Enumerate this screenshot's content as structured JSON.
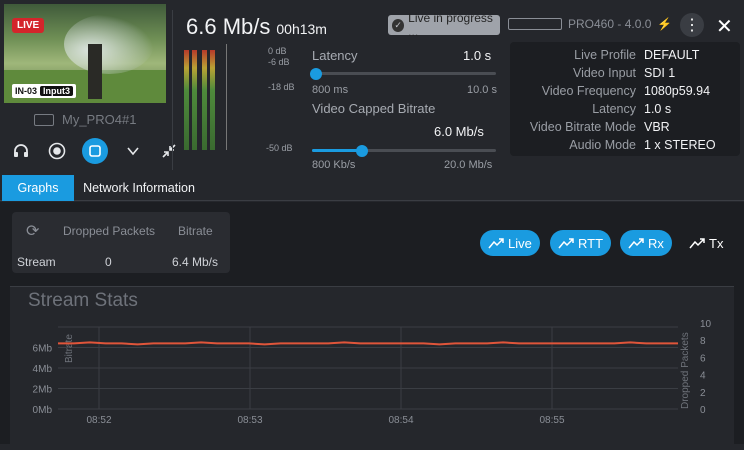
{
  "preview": {
    "live_badge": "LIVE",
    "input_code": "IN-03",
    "input_tag": "Input3",
    "device_name": "My_PRO4#1"
  },
  "header": {
    "bitrate": "6.6 Mb/s",
    "duration": "00h13m",
    "status": "Live in progress ...",
    "device_version": "PRO460 - 4.0.0"
  },
  "audio_meter": {
    "scale": [
      "0 dB",
      "-6 dB",
      "-18 dB",
      "-50 dB"
    ]
  },
  "latency": {
    "label": "Latency",
    "value": "1.0 s",
    "min": "800 ms",
    "max": "10.0 s",
    "position": 0.02
  },
  "capped_bitrate": {
    "label": "Video Capped Bitrate",
    "value": "6.0 Mb/s",
    "min": "800 Kb/s",
    "max": "20.0 Mb/s",
    "position": 0.27
  },
  "info": [
    {
      "k": "Live Profile",
      "v": "DEFAULT"
    },
    {
      "k": "Video Input",
      "v": "SDI 1"
    },
    {
      "k": "Video Frequency",
      "v": "1080p59.94"
    },
    {
      "k": "Latency",
      "v": "1.0 s"
    },
    {
      "k": "Video Bitrate Mode",
      "v": "VBR"
    },
    {
      "k": "Audio Mode",
      "v": "1 x STEREO"
    }
  ],
  "tabs": {
    "graphs": "Graphs",
    "network": "Network Information"
  },
  "stats": {
    "col1": "Dropped Packets",
    "col2": "Bitrate",
    "row": "Stream",
    "dropped": "0",
    "bitrate": "6.4 Mb/s"
  },
  "graph_buttons": {
    "live": "Live",
    "rtt": "RTT",
    "rx": "Rx",
    "tx": "Tx"
  },
  "chart_data": {
    "type": "line",
    "title": "Stream Stats",
    "ylabel": "Bitrate",
    "y2label": "Dropped Packets",
    "ylim": [
      0,
      8
    ],
    "y2lim": [
      0,
      10
    ],
    "y_ticks": [
      "0Mb",
      "2Mb",
      "4Mb",
      "6Mb"
    ],
    "y2_ticks": [
      "0",
      "2",
      "4",
      "6",
      "8",
      "10"
    ],
    "x_ticks": [
      "08:52",
      "08:53",
      "08:54",
      "08:55"
    ],
    "series": [
      {
        "name": "Bitrate",
        "color": "#e0553a",
        "values": [
          6.4,
          6.4,
          6.5,
          6.4,
          6.4,
          6.3,
          6.4,
          6.4,
          6.4,
          6.5,
          6.4,
          6.4,
          6.4,
          6.3,
          6.4,
          6.4,
          6.4,
          6.4,
          6.5,
          6.4,
          6.4,
          6.4,
          6.4,
          6.4,
          6.3,
          6.4,
          6.4,
          6.4,
          6.5,
          6.4,
          6.4,
          6.4,
          6.4,
          6.4,
          6.4,
          6.4,
          6.5,
          6.4,
          6.4,
          6.4
        ]
      }
    ]
  },
  "colors": {
    "accent": "#1a9be0",
    "live": "#d4252b",
    "line": "#e0553a"
  }
}
